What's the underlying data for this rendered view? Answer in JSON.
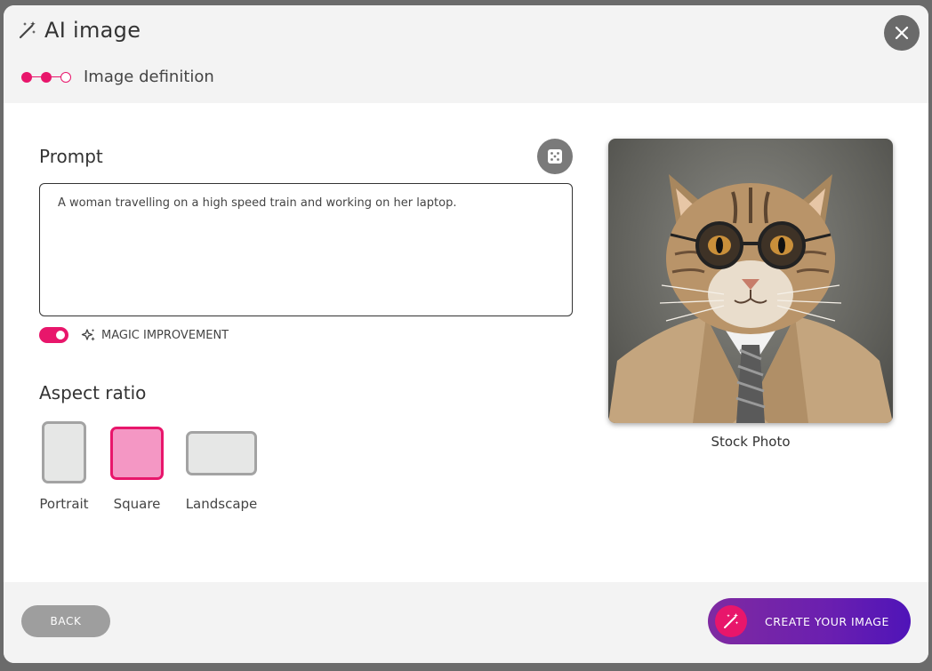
{
  "dialog": {
    "title": "AI image",
    "step_label": "Image definition"
  },
  "prompt": {
    "heading": "Prompt",
    "value": "A woman travelling on a high speed train and working on her laptop.",
    "magic_label": "MAGIC IMPROVEMENT",
    "magic_enabled": true
  },
  "aspect": {
    "heading": "Aspect ratio",
    "options": [
      {
        "label": "Portrait",
        "selected": false
      },
      {
        "label": "Square",
        "selected": true
      },
      {
        "label": "Landscape",
        "selected": false
      }
    ]
  },
  "preview": {
    "caption": "Stock Photo"
  },
  "footer": {
    "back_label": "BACK",
    "create_label": "CREATE YOUR IMAGE"
  },
  "colors": {
    "accent": "#e8166b",
    "accent_light": "#f497c4",
    "create_gradient_start": "#7f2aa1",
    "create_gradient_end": "#4f14b8"
  }
}
